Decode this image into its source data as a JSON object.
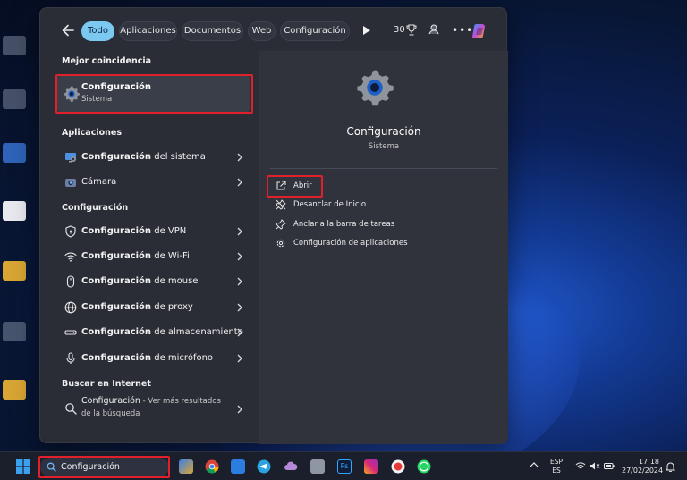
{
  "filters": {
    "tabs": [
      {
        "label": "Todo",
        "active": true
      },
      {
        "label": "Aplicaciones",
        "active": false
      },
      {
        "label": "Documentos",
        "active": false
      },
      {
        "label": "Web",
        "active": false
      },
      {
        "label": "Configuración",
        "active": false
      }
    ],
    "points": "30"
  },
  "best_match": {
    "heading": "Mejor coincidencia",
    "title": "Configuración",
    "subtitle": "Sistema"
  },
  "apps": {
    "heading": "Aplicaciones",
    "items": [
      {
        "bold": "Configuración",
        "rest": " del sistema"
      },
      {
        "bold": "",
        "rest": "Cámara"
      }
    ]
  },
  "settings": {
    "heading": "Configuración",
    "items": [
      {
        "bold": "Configuración",
        "rest": " de VPN"
      },
      {
        "bold": "Configuración",
        "rest": " de Wi-Fi"
      },
      {
        "bold": "Configuración",
        "rest": " de mouse"
      },
      {
        "bold": "Configuración",
        "rest": " de proxy"
      },
      {
        "bold": "Configuración",
        "rest": " de almacenamiento"
      },
      {
        "bold": "Configuración",
        "rest": " de micrófono"
      }
    ]
  },
  "web": {
    "heading": "Buscar en Internet",
    "query": "Configuración",
    "suffix": " - Ver más resultados de la búsqueda"
  },
  "preview": {
    "title": "Configuración",
    "subtitle": "Sistema",
    "actions": [
      "Abrir",
      "Desanclar de Inicio",
      "Anclar a la barra de tareas",
      "Configuración de aplicaciones"
    ]
  },
  "taskbar": {
    "search_value": "Configuración",
    "lang_top": "ESP",
    "lang_bottom": "ES",
    "time": "17:18",
    "date": "27/02/2024"
  },
  "colors": {
    "accent": "#7bc8f0",
    "highlight": "#e0202a"
  }
}
